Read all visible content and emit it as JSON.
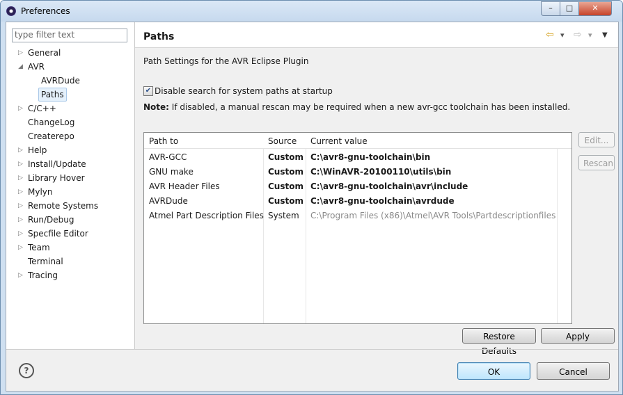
{
  "window": {
    "title": "Preferences",
    "minimize": "–",
    "maximize": "□",
    "close": "✕"
  },
  "filter": {
    "placeholder": "type filter text"
  },
  "tree": [
    {
      "label": "General",
      "arrow": "▷",
      "level": 0
    },
    {
      "label": "AVR",
      "arrow": "◢",
      "level": 0
    },
    {
      "label": "AVRDude",
      "arrow": "",
      "level": 1
    },
    {
      "label": "Paths",
      "arrow": "",
      "level": 1,
      "selected": true
    },
    {
      "label": "C/C++",
      "arrow": "▷",
      "level": 0
    },
    {
      "label": "ChangeLog",
      "arrow": "",
      "level": 0
    },
    {
      "label": "Createrepo",
      "arrow": "",
      "level": 0
    },
    {
      "label": "Help",
      "arrow": "▷",
      "level": 0
    },
    {
      "label": "Install/Update",
      "arrow": "▷",
      "level": 0
    },
    {
      "label": "Library Hover",
      "arrow": "▷",
      "level": 0
    },
    {
      "label": "Mylyn",
      "arrow": "▷",
      "level": 0
    },
    {
      "label": "Remote Systems",
      "arrow": "▷",
      "level": 0
    },
    {
      "label": "Run/Debug",
      "arrow": "▷",
      "level": 0
    },
    {
      "label": "Specfile Editor",
      "arrow": "▷",
      "level": 0
    },
    {
      "label": "Team",
      "arrow": "▷",
      "level": 0
    },
    {
      "label": "Terminal",
      "arrow": "",
      "level": 0
    },
    {
      "label": "Tracing",
      "arrow": "▷",
      "level": 0
    }
  ],
  "page": {
    "title": "Paths",
    "description": "Path Settings for the AVR Eclipse Plugin",
    "checkbox_label": "Disable search for system paths at startup",
    "checkbox_checked": true,
    "note_prefix": "Note:",
    "note_text": " If disabled, a manual rescan may be required when a new avr-gcc toolchain has been installed.",
    "nav": {
      "back": "⇦",
      "forward": "⇨",
      "dropdown": "▾",
      "menu": "▼"
    }
  },
  "table": {
    "headers": [
      "Path to",
      "Source",
      "Current value"
    ],
    "rows": [
      {
        "path": "AVR-GCC",
        "source": "Custom",
        "value": "C:\\avr8-gnu-toolchain\\bin",
        "custom": true
      },
      {
        "path": "GNU make",
        "source": "Custom",
        "value": "C:\\WinAVR-20100110\\utils\\bin",
        "custom": true
      },
      {
        "path": "AVR Header Files",
        "source": "Custom",
        "value": "C:\\avr8-gnu-toolchain\\avr\\include",
        "custom": true
      },
      {
        "path": "AVRDude",
        "source": "Custom",
        "value": "C:\\avr8-gnu-toolchain\\avrdude",
        "custom": true
      },
      {
        "path": "Atmel Part Description Files",
        "source": "System",
        "value": "C:\\Program Files (x86)\\Atmel\\AVR Tools\\Partdescriptionfiles",
        "custom": false
      }
    ]
  },
  "buttons": {
    "edit": "Edit...",
    "rescan": "Rescan",
    "restore": "Restore Defaults",
    "apply": "Apply",
    "ok": "OK",
    "cancel": "Cancel",
    "help": "?"
  },
  "colors": {
    "accent": "#3c7fb1",
    "selection": "#e4f0fb"
  }
}
